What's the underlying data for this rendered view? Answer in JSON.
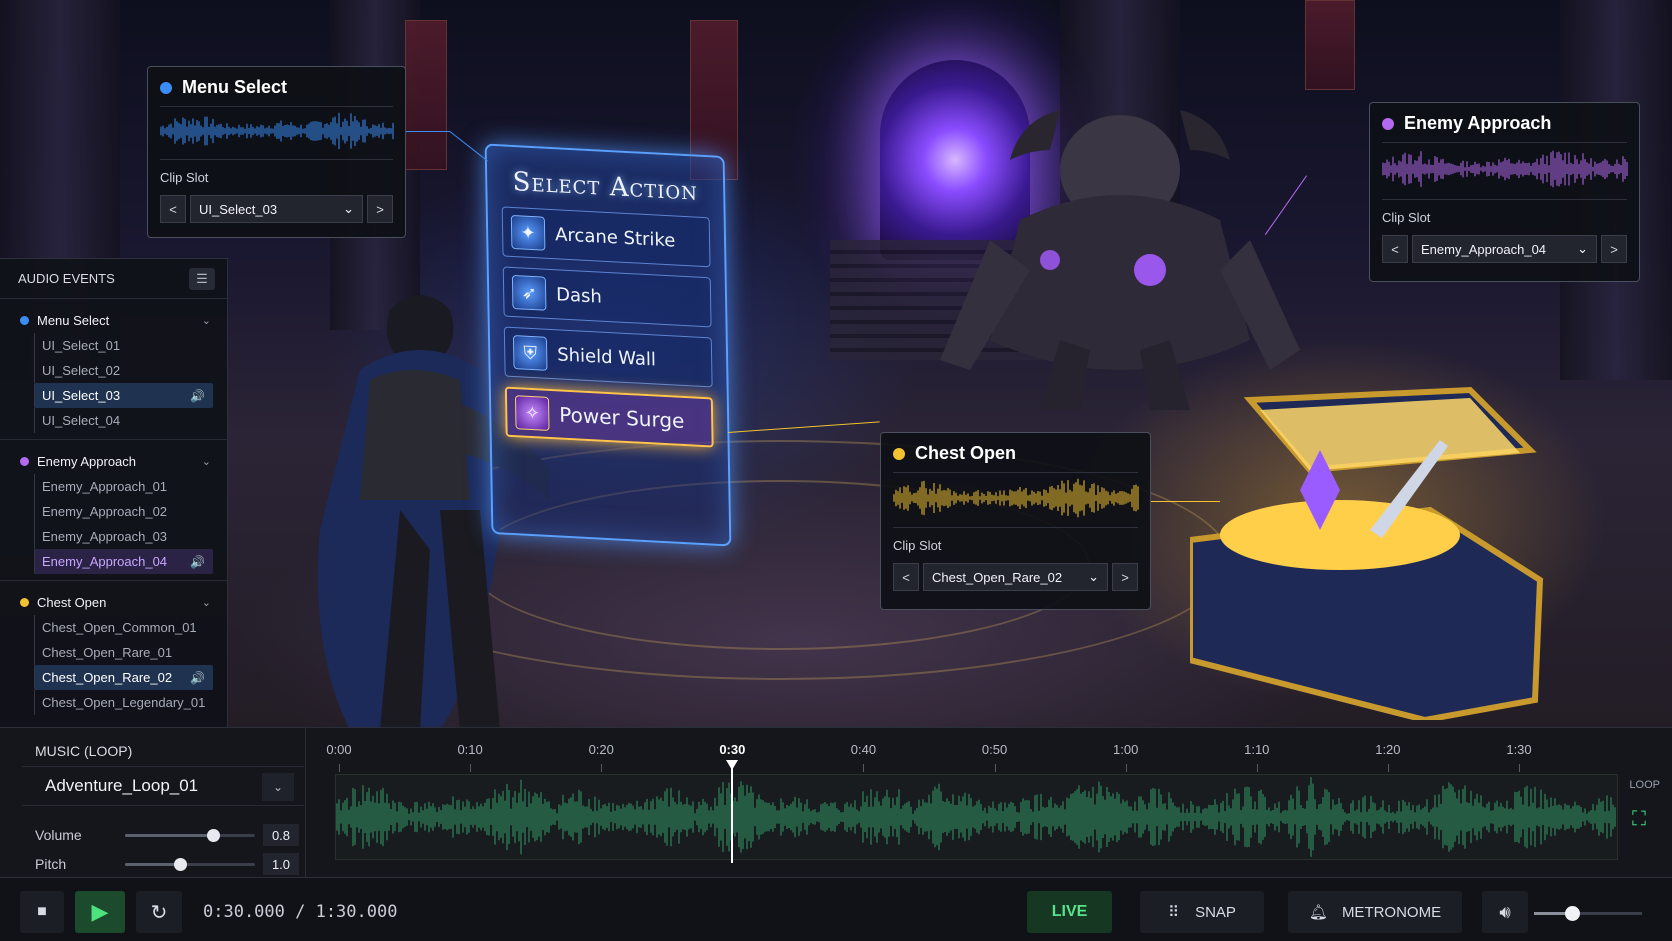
{
  "colors": {
    "menu_select": "#3b8df5",
    "enemy_approach": "#b46af0",
    "chest_open": "#f2c230",
    "music_wave": "#2f9a64",
    "live": "#58e28a"
  },
  "select_menu": {
    "title": "Select Action",
    "options": [
      {
        "label": "Arcane Strike",
        "icon": "arcane-strike-icon"
      },
      {
        "label": "Dash",
        "icon": "dash-icon"
      },
      {
        "label": "Shield Wall",
        "icon": "shield-icon"
      },
      {
        "label": "Power Surge",
        "icon": "power-surge-icon",
        "selected": true
      }
    ]
  },
  "cards": {
    "menu_select": {
      "title": "Menu Select",
      "clip_label": "Clip Slot",
      "clip": "UI_Select_03"
    },
    "enemy_approach": {
      "title": "Enemy Approach",
      "clip_label": "Clip Slot",
      "clip": "Enemy_Approach_04"
    },
    "chest_open": {
      "title": "Chest Open",
      "clip_label": "Clip Slot",
      "clip": "Chest_Open_Rare_02"
    }
  },
  "sidebar": {
    "title": "AUDIO EVENTS",
    "groups": [
      {
        "name": "Menu Select",
        "clips": [
          "UI_Select_01",
          "UI_Select_02",
          "UI_Select_03",
          "UI_Select_04"
        ],
        "selected": 2
      },
      {
        "name": "Enemy Approach",
        "clips": [
          "Enemy_Approach_01",
          "Enemy_Approach_02",
          "Enemy_Approach_03",
          "Enemy_Approach_04"
        ],
        "selected": 3
      },
      {
        "name": "Chest Open",
        "clips": [
          "Chest_Open_Common_01",
          "Chest_Open_Rare_01",
          "Chest_Open_Rare_02",
          "Chest_Open_Legendary_01"
        ],
        "selected": 2
      }
    ]
  },
  "music": {
    "title": "MUSIC (LOOP)",
    "track": "Adventure_Loop_01",
    "volume_label": "Volume",
    "volume": "0.8",
    "pitch_label": "Pitch",
    "pitch": "1.0",
    "ticks": [
      "0:00",
      "0:10",
      "0:20",
      "0:30",
      "0:40",
      "0:50",
      "1:00",
      "1:10",
      "1:20",
      "1:30"
    ],
    "playhead_seconds": 30,
    "duration_seconds": 90,
    "loop_label": "LOOP"
  },
  "transport": {
    "timecode": "0:30.000 / 1:30.000",
    "live_label": "LIVE",
    "snap_label": "SNAP",
    "metronome_label": "METRONOME",
    "master_volume": 0.35
  }
}
